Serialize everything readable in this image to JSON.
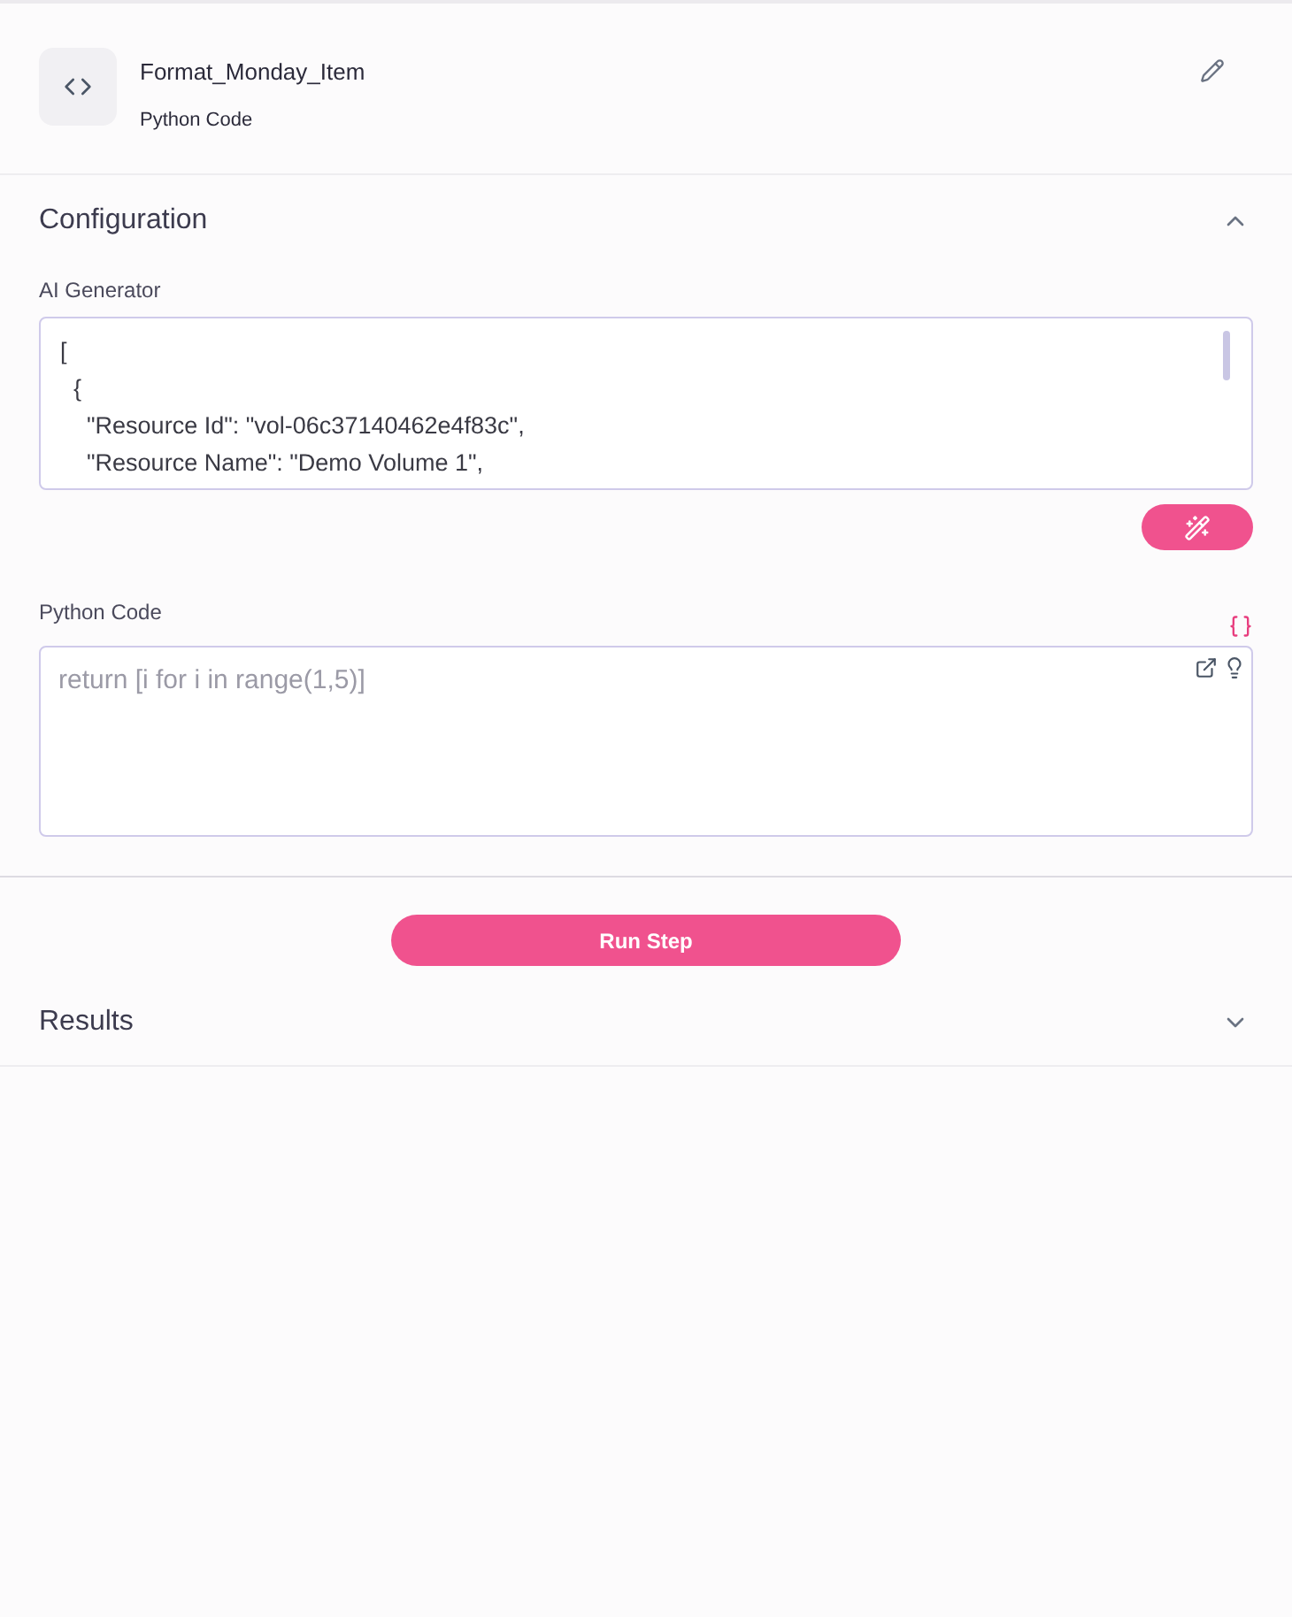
{
  "header": {
    "title": "Format_Monday_Item",
    "subtitle": "Python Code"
  },
  "configuration": {
    "title": "Configuration",
    "expanded": true,
    "ai_generator": {
      "label": "AI Generator",
      "value": "[\n  {\n    \"Resource Id\": \"vol-06c37140462e4f83c\",\n    \"Resource Name\": \"Demo Volume 1\","
    },
    "python_code": {
      "label": "Python Code",
      "placeholder": "return [i for i in range(1,5)]"
    }
  },
  "run_button": "Run Step",
  "results": {
    "title": "Results",
    "expanded": false
  }
}
